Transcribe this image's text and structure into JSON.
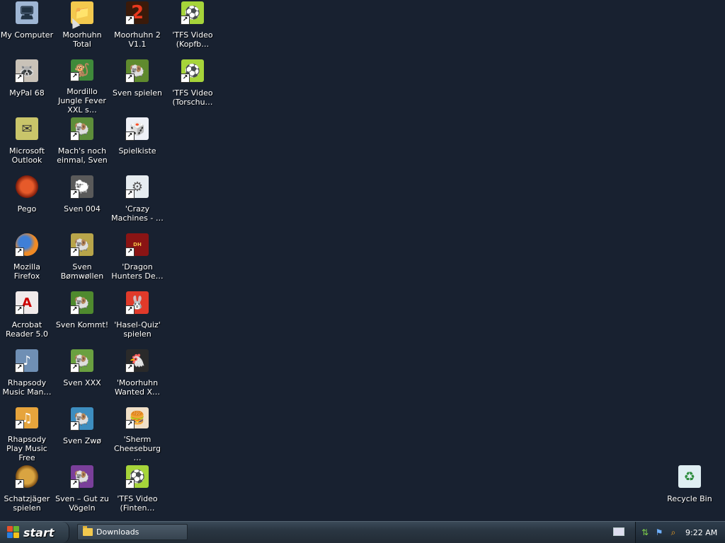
{
  "desktop_icons": [
    {
      "label": "My Computer",
      "icon": "computer-icon"
    },
    {
      "label": "Moorhuhn Total",
      "icon": "folder-icon"
    },
    {
      "label": "Moorhuhn 2 V1.1",
      "icon": "moorhuhn2-icon"
    },
    {
      "label": "'TFS Video (Kopfb…",
      "icon": "tfs-video-icon"
    },
    {
      "label": "MyPal 68",
      "icon": "mypal-icon"
    },
    {
      "label": "Mordillo Jungle Fever XXL s…",
      "icon": "mordillo-icon"
    },
    {
      "label": "Sven spielen",
      "icon": "sven-icon"
    },
    {
      "label": "'TFS Video (Torschu…",
      "icon": "tfs-video-icon"
    },
    {
      "label": "Microsoft Outlook",
      "icon": "outlook-icon"
    },
    {
      "label": "Mach's noch einmal, Sven",
      "icon": "sven-icon"
    },
    {
      "label": "Spielkiste",
      "icon": "spielkiste-icon"
    },
    {
      "label": "Pego",
      "icon": "pego-icon"
    },
    {
      "label": "Sven 004",
      "icon": "sven004-icon"
    },
    {
      "label": "'Crazy Machines - …",
      "icon": "crazy-machines-icon"
    },
    {
      "label": "Mozilla Firefox",
      "icon": "firefox-icon"
    },
    {
      "label": "Sven Bømwøllen",
      "icon": "sven-icon"
    },
    {
      "label": "'Dragon Hunters De…",
      "icon": "dragon-hunters-icon"
    },
    {
      "label": "Acrobat Reader 5.0",
      "icon": "acrobat-icon"
    },
    {
      "label": "Sven Kommt!",
      "icon": "sven-icon"
    },
    {
      "label": "'Hasel-Quiz' spielen",
      "icon": "hasel-icon"
    },
    {
      "label": "Rhapsody Music Man…",
      "icon": "rhapsody-icon"
    },
    {
      "label": "Sven XXX",
      "icon": "sven-icon"
    },
    {
      "label": "'Moorhuhn Wanted X…",
      "icon": "moorhuhn-wanted-icon"
    },
    {
      "label": "Rhapsody Play Music Free",
      "icon": "rhapsody-play-icon"
    },
    {
      "label": "Sven Zwø",
      "icon": "sven-icon"
    },
    {
      "label": "'Sherm Cheeseburg…",
      "icon": "sherm-icon"
    },
    {
      "label": "Schatzjäger spielen",
      "icon": "schatzjaeger-icon"
    },
    {
      "label": "Sven – Gut zu Vögeln",
      "icon": "sven-icon"
    },
    {
      "label": "'TFS Video (Finten…",
      "icon": "tfs-video-icon"
    },
    {
      "label": "Recycle Bin",
      "icon": "recycle-bin-icon"
    }
  ],
  "taskbar": {
    "start_label": "start",
    "tasks": [
      {
        "label": "Downloads",
        "icon": "folder-icon"
      }
    ],
    "clock": "9:22 AM"
  },
  "colors": {
    "desktop": "#182130",
    "taskbar": "#2a3642"
  }
}
